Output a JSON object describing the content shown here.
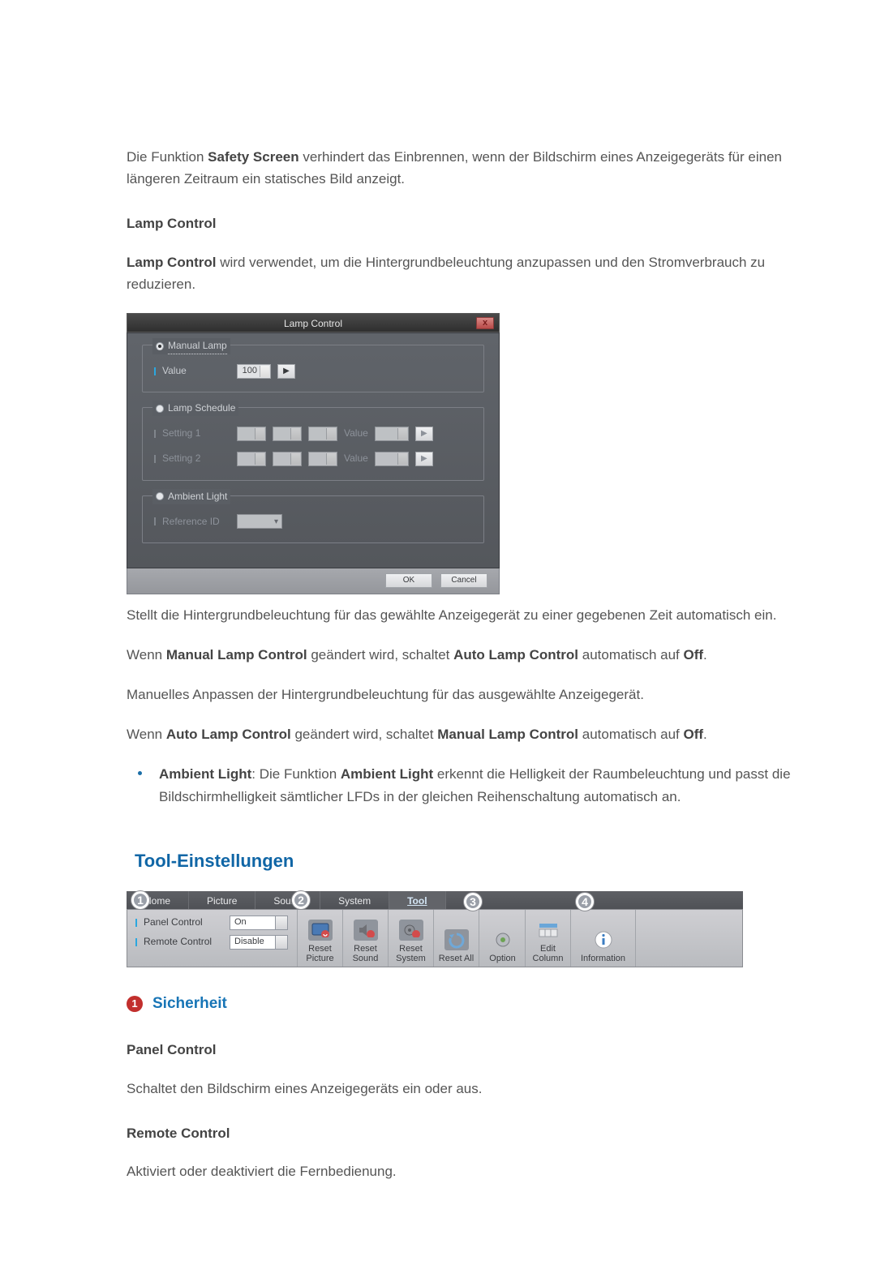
{
  "intro": {
    "p1_a": "Die Funktion ",
    "p1_b": "Safety Screen",
    "p1_c": " verhindert das Einbrennen, wenn der Bildschirm eines Anzeigegeräts für einen längeren Zeitraum ein statisches Bild anzeigt."
  },
  "lamp": {
    "heading": "Lamp Control",
    "p1_a": "Lamp Control",
    "p1_b": " wird verwendet, um die Hintergrundbeleuchtung anzupassen und den Stromverbrauch zu reduzieren.",
    "after_img": "Stellt die Hintergrundbeleuchtung für das gewählte Anzeigegerät zu einer gegebenen Zeit automatisch ein.",
    "p3": {
      "a": "Wenn ",
      "b": "Manual Lamp Control",
      "c": " geändert wird, schaltet ",
      "d": "Auto Lamp Control",
      "e": " automatisch auf ",
      "f": "Off",
      "g": "."
    },
    "p4": "Manuelles Anpassen der Hintergrundbeleuchtung für das ausgewählte Anzeigegerät.",
    "p5": {
      "a": "Wenn ",
      "b": "Auto Lamp Control",
      "c": " geändert wird, schaltet ",
      "d": "Manual Lamp Control",
      "e": " automatisch auf ",
      "f": "Off",
      "g": "."
    },
    "bullet": {
      "a": "Ambient Light",
      "b": ": Die Funktion ",
      "c": "Ambient Light",
      "d": " erkennt die Helligkeit der Raumbeleuchtung und passt die Bildschirmhelligkeit sämtlicher LFDs in der gleichen Reihenschaltung automatisch an."
    }
  },
  "dialog": {
    "title": "Lamp Control",
    "groups": {
      "manual": {
        "label": "Manual Lamp",
        "row": "Value",
        "value": "100"
      },
      "schedule": {
        "label": "Lamp Schedule",
        "row1": "Setting 1",
        "row2": "Setting 2",
        "value_label": "Value"
      },
      "ambient": {
        "label": "Ambient Light",
        "row": "Reference ID"
      }
    },
    "ok": "OK",
    "cancel": "Cancel"
  },
  "tools": {
    "heading": "Tool-Einstellungen",
    "tabs": {
      "home": "Home",
      "picture": "Picture",
      "sound": "Sound",
      "system": "System",
      "tool": "Tool"
    },
    "security": {
      "panel_label": "Panel Control",
      "panel_value": "On",
      "remote_label": "Remote Control",
      "remote_value": "Disable"
    },
    "reset": {
      "picture": "Reset Picture",
      "sound": "Reset Sound",
      "system": "Reset System",
      "all": "Reset All"
    },
    "right": {
      "option": "Option",
      "edit": "Edit Column",
      "info": "Information"
    },
    "bubbles": {
      "n1": "1",
      "n2": "2",
      "n3": "3",
      "n4": "4"
    }
  },
  "sec1": {
    "title": "Sicherheit",
    "badge": "1",
    "panel_h": "Panel Control",
    "panel_p": "Schaltet den Bildschirm eines Anzeigegeräts ein oder aus.",
    "remote_h": "Remote Control",
    "remote_p": "Aktiviert oder deaktiviert die Fernbedienung."
  }
}
